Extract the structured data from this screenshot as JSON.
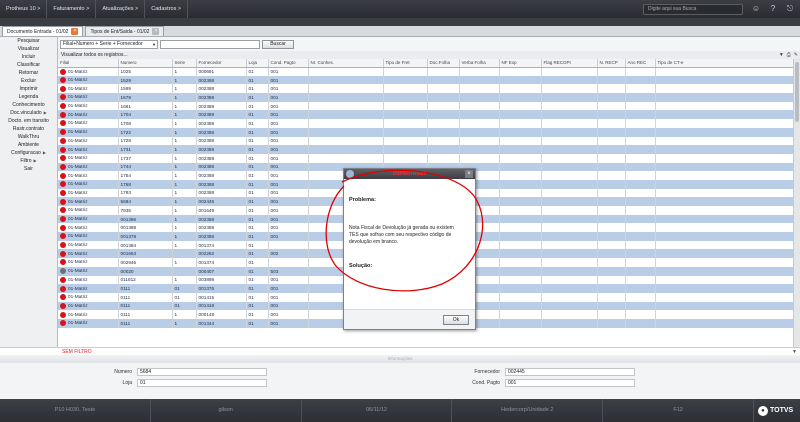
{
  "topbar": {
    "crumbs": [
      "Protheus 10 >",
      "Faturamento >",
      "Atualizações >",
      "Cadastros >"
    ],
    "search_placeholder": "Digite aqui sua Busca"
  },
  "tabs": [
    {
      "label": "Documento Entrada - 01/02",
      "active": true
    },
    {
      "label": "Tipos de Ent/Saida - 01/02",
      "active": false
    }
  ],
  "sidebar": {
    "items": [
      {
        "label": "Pesquisar",
        "arrow": false
      },
      {
        "label": "Visualizar",
        "arrow": false
      },
      {
        "label": "Incluir",
        "arrow": false
      },
      {
        "label": "Classificar",
        "arrow": false
      },
      {
        "label": "Retornar",
        "arrow": false
      },
      {
        "label": "Excluir",
        "arrow": false
      },
      {
        "label": "Imprimir",
        "arrow": false
      },
      {
        "label": "Legenda",
        "arrow": false
      },
      {
        "label": "Conhecimento",
        "arrow": false
      },
      {
        "label": "Doc.vinculado",
        "arrow": true
      },
      {
        "label": "Docto. em transito",
        "arrow": false
      },
      {
        "label": "Rastr.contrato",
        "arrow": false
      },
      {
        "label": "WalkThru",
        "arrow": false
      },
      {
        "label": "Ambiente",
        "arrow": false
      },
      {
        "label": "Configuracao",
        "arrow": true
      },
      {
        "label": "Filtro",
        "arrow": true
      },
      {
        "label": "Sair",
        "arrow": false
      }
    ]
  },
  "filterbar": {
    "select_value": "Filial+Numero + Serie + Fornecedor",
    "search_label": "Buscar"
  },
  "viewbar": {
    "text": "Visualizar todos os registros..."
  },
  "grid": {
    "columns": [
      "Filial",
      "Numero",
      "Serie",
      "Fornecedor",
      "Loja",
      "Cond. Pagto",
      "Nr. Conhec.",
      "Tipo de Fret",
      "Doc.Folha",
      "Verba Folha",
      "NF Exp",
      "Flag RECOPI",
      "N. RECP",
      "Ano REC",
      "Tipo de CT-e"
    ],
    "rows": [
      {
        "filial": "01-Matriz",
        "numero": "1025",
        "serie": "1",
        "fornecedor": "000691",
        "loja": "01",
        "cond": "001"
      },
      {
        "filial": "01-Matriz",
        "numero": "1529",
        "serie": "1",
        "fornecedor": "002388",
        "loja": "01",
        "cond": "001"
      },
      {
        "filial": "01-Matriz",
        "numero": "1599",
        "serie": "1",
        "fornecedor": "002388",
        "loja": "01",
        "cond": "001"
      },
      {
        "filial": "01-Matriz",
        "numero": "1679",
        "serie": "1",
        "fornecedor": "002388",
        "loja": "01",
        "cond": "001"
      },
      {
        "filial": "01-Matriz",
        "numero": "1681",
        "serie": "1",
        "fornecedor": "002388",
        "loja": "01",
        "cond": "001"
      },
      {
        "filial": "01-Matriz",
        "numero": "1704",
        "serie": "1",
        "fornecedor": "002388",
        "loja": "01",
        "cond": "001"
      },
      {
        "filial": "01-Matriz",
        "numero": "1708",
        "serie": "1",
        "fornecedor": "002388",
        "loja": "01",
        "cond": "001"
      },
      {
        "filial": "01-Matriz",
        "numero": "1722",
        "serie": "1",
        "fornecedor": "002388",
        "loja": "01",
        "cond": "001"
      },
      {
        "filial": "01-Matriz",
        "numero": "1728",
        "serie": "1",
        "fornecedor": "002388",
        "loja": "01",
        "cond": "001"
      },
      {
        "filial": "01-Matriz",
        "numero": "1731",
        "serie": "1",
        "fornecedor": "002388",
        "loja": "01",
        "cond": "001"
      },
      {
        "filial": "01-Matriz",
        "numero": "1737",
        "serie": "1",
        "fornecedor": "002388",
        "loja": "01",
        "cond": "001"
      },
      {
        "filial": "01-Matriz",
        "numero": "1744",
        "serie": "1",
        "fornecedor": "002388",
        "loja": "01",
        "cond": "001"
      },
      {
        "filial": "01-Matriz",
        "numero": "1754",
        "serie": "1",
        "fornecedor": "002388",
        "loja": "01",
        "cond": "001"
      },
      {
        "filial": "01-Matriz",
        "numero": "1768",
        "serie": "1",
        "fornecedor": "002388",
        "loja": "01",
        "cond": "001"
      },
      {
        "filial": "01-Matriz",
        "numero": "1793",
        "serie": "1",
        "fornecedor": "002388",
        "loja": "01",
        "cond": "001"
      },
      {
        "filial": "01-Matriz",
        "numero": "5684",
        "serie": "1",
        "fornecedor": "002445",
        "loja": "01",
        "cond": "001"
      },
      {
        "filial": "01-Matriz",
        "numero": "7935",
        "serie": "1",
        "fornecedor": "001649",
        "loja": "01",
        "cond": "001"
      },
      {
        "filial": "01-Matriz",
        "numero": "001386",
        "serie": "1",
        "fornecedor": "002388",
        "loja": "01",
        "cond": "001"
      },
      {
        "filial": "01-Matriz",
        "numero": "001388",
        "serie": "1",
        "fornecedor": "002388",
        "loja": "01",
        "cond": "001"
      },
      {
        "filial": "01-Matriz",
        "numero": "001378",
        "serie": "1",
        "fornecedor": "002388",
        "loja": "01",
        "cond": "001"
      },
      {
        "filial": "01-Matriz",
        "numero": "001384",
        "serie": "1",
        "fornecedor": "001374",
        "loja": "01",
        "cond": ""
      },
      {
        "filial": "01-Matriz",
        "numero": "001663",
        "serie": "",
        "fornecedor": "002282",
        "loja": "01",
        "cond": "002"
      },
      {
        "filial": "01-Matriz",
        "numero": "002946",
        "serie": "1",
        "fornecedor": "001374",
        "loja": "01",
        "cond": ""
      },
      {
        "filial": "01-Matriz",
        "numero": "00020",
        "serie": "",
        "fornecedor": "000407",
        "loja": "01",
        "cond": "503"
      },
      {
        "filial": "01-Matriz",
        "numero": "011812",
        "serie": "1",
        "fornecedor": "003898",
        "loja": "01",
        "cond": "001"
      },
      {
        "filial": "01-Matriz",
        "numero": "0111",
        "serie": "01",
        "fornecedor": "001376",
        "loja": "01",
        "cond": "001"
      },
      {
        "filial": "01-Matriz",
        "numero": "0111",
        "serie": "01",
        "fornecedor": "001415",
        "loja": "01",
        "cond": "001"
      },
      {
        "filial": "01-Matriz",
        "numero": "0111",
        "serie": "01",
        "fornecedor": "001418",
        "loja": "01",
        "cond": "001"
      },
      {
        "filial": "01-Matriz",
        "numero": "0111",
        "serie": "1",
        "fornecedor": "000148",
        "loja": "01",
        "cond": "001"
      },
      {
        "filial": "01-Matriz",
        "numero": "0111",
        "serie": "1",
        "fornecedor": "001344",
        "loja": "01",
        "cond": "001"
      }
    ]
  },
  "filter_status": "SEM FILTRO",
  "separator_label": "Informações",
  "details": {
    "numero_label": "Numero",
    "numero_value": "5684",
    "loja_label": "Loja",
    "loja_value": "01",
    "fornecedor_label": "Fornecedor",
    "fornecedor_value": "002445",
    "cond_label": "Cond. Pagto",
    "cond_value": "001"
  },
  "statusbar": {
    "cells": [
      "P10 H030, Teste",
      "gilson",
      "06/11/12",
      "Hedercorp/Unidade 2",
      "F12"
    ],
    "brand": "TOTVS"
  },
  "dialog": {
    "title": "DSPADTRSNT",
    "problem_label": "Problema:",
    "message": "Nota Fiscal de Devolução já gerada ou existem TES que sofrao com seu respectivo código de devolução em branco.",
    "solution_label": "Solução:",
    "ok_label": "Ok"
  },
  "colors": {
    "row_alt": "#b9cde6",
    "status_dot": "#d6121b",
    "annotation": "#e00000",
    "tab_close": "#e57b38"
  }
}
